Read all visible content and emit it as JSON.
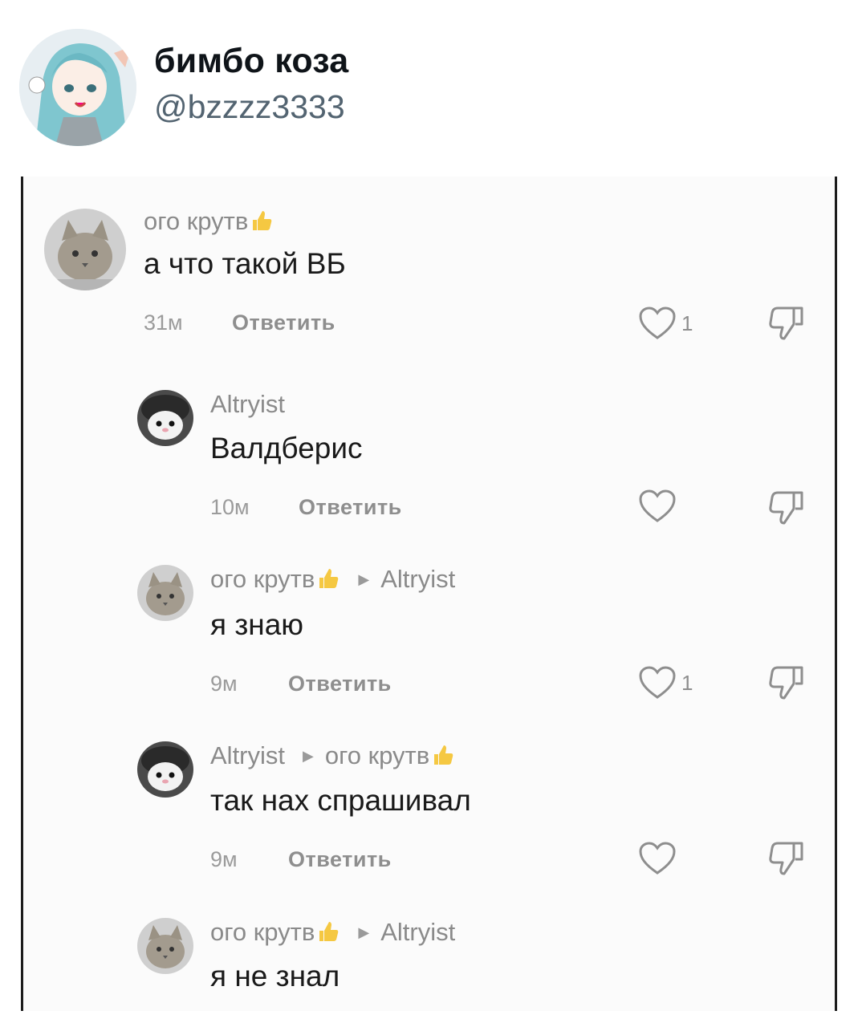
{
  "tweet": {
    "display_name": "бимбо коза",
    "handle": "@bzzzz3333"
  },
  "comments": [
    {
      "author": "ого крутв",
      "reply_to": "",
      "text": "а что такой ВБ",
      "time": "31м",
      "reply_label": "Ответить",
      "likes": "1"
    },
    {
      "author": "Altryist",
      "reply_to": "",
      "text": "Валдберис",
      "time": "10м",
      "reply_label": "Ответить",
      "likes": ""
    },
    {
      "author": "ого крутв",
      "reply_to": "Altryist",
      "text": "я знаю",
      "time": "9м",
      "reply_label": "Ответить",
      "likes": "1"
    },
    {
      "author": "Altryist",
      "reply_to": "ого крутв",
      "text": "так нах спрашивал",
      "time": "9м",
      "reply_label": "Ответить",
      "likes": ""
    },
    {
      "author": "ого крутв",
      "reply_to": "Altryist",
      "text": "я не знал",
      "time": "",
      "reply_label": "",
      "likes": ""
    }
  ],
  "icons": {
    "like": "heart-outline-icon",
    "dislike": "thumbs-down-outline-icon",
    "author_emoji": "thumbs-up-emoji-icon",
    "reply_arrow": "triangle-right-icon"
  },
  "colors": {
    "muted_text": "#8a8a8a",
    "main_text": "#1a1a1a",
    "emoji": "#f5c842",
    "handle": "#536471"
  }
}
